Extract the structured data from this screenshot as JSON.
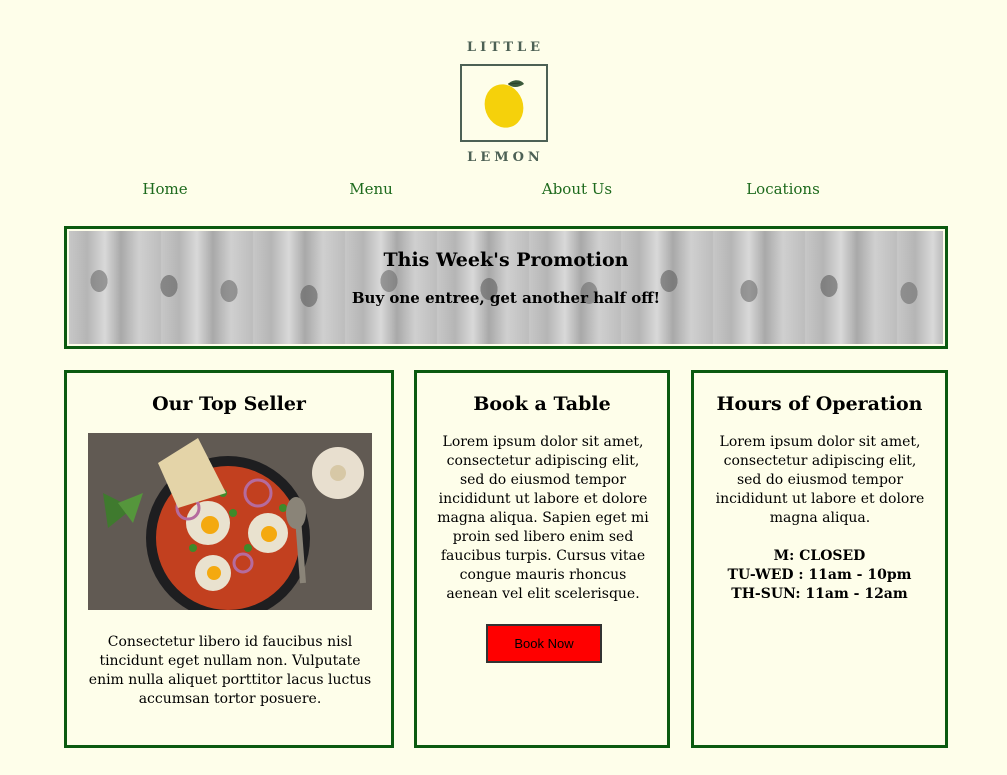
{
  "logo": {
    "top": "LITTLE",
    "bottom": "LEMON"
  },
  "nav": [
    "Home",
    "Menu",
    "About Us",
    "Locations"
  ],
  "promo": {
    "title": "This Week's Promotion",
    "subtitle": "Buy one entree, get another half off!"
  },
  "cards": {
    "top_seller": {
      "title": "Our Top Seller",
      "text": "Consectetur libero id faucibus nisl tincidunt eget nullam non. Vulputate enim nulla aliquet porttitor lacus luctus accumsan tortor posuere."
    },
    "book": {
      "title": "Book a Table",
      "text": "Lorem ipsum dolor sit amet, consectetur adipiscing elit, sed do eiusmod tempor incididunt ut labore et dolore magna aliqua. Sapien eget mi proin sed libero enim sed faucibus turpis. Cursus vitae congue mauris rhoncus aenean vel elit scelerisque.",
      "button": "Book Now"
    },
    "hours": {
      "title": "Hours of Operation",
      "text": "Lorem ipsum dolor sit amet, consectetur adipiscing elit, sed do eiusmod tempor incididunt ut labore et dolore magna aliqua.",
      "lines": [
        "M: CLOSED",
        "TU-WED : 11am - 10pm",
        "TH-SUN: 11am - 12am"
      ]
    }
  },
  "colors": {
    "background": "#fefeea",
    "accent_green": "#0b5a10",
    "nav_green": "#1d6a1d",
    "button_red": "#ff0000",
    "logo_gray": "#4d6155",
    "lemon": "#f5d10b"
  },
  "icons": {
    "logo": "lemon-icon"
  }
}
